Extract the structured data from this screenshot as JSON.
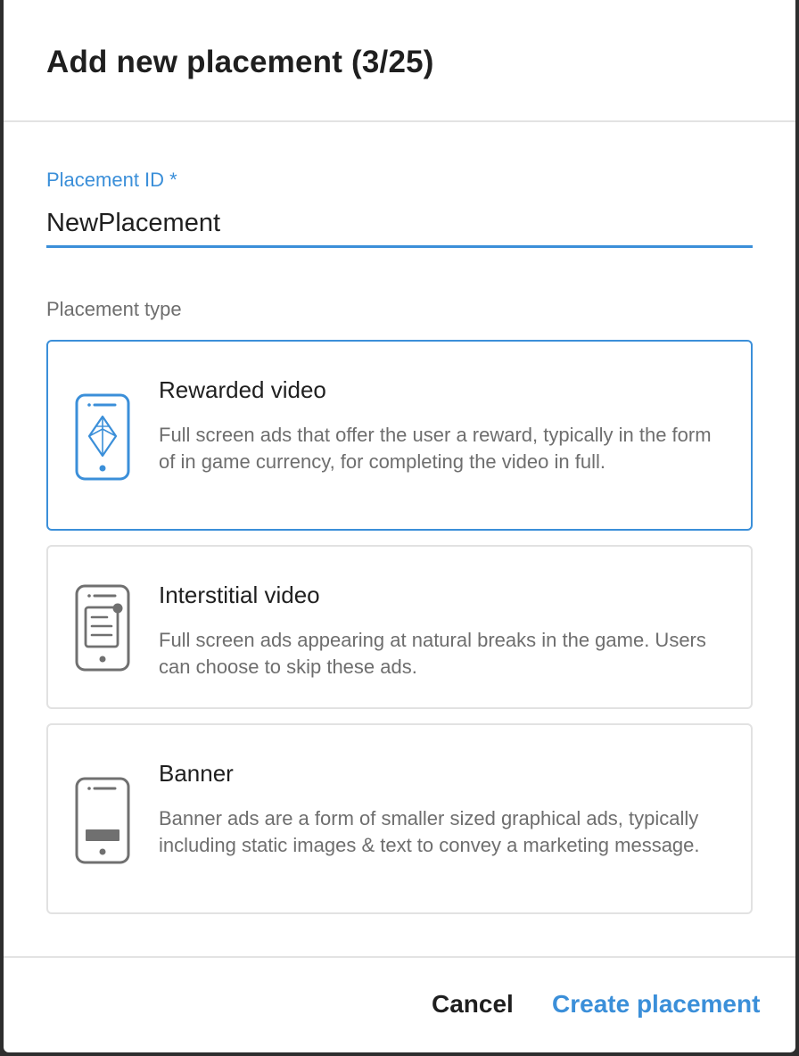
{
  "dialog": {
    "title": "Add new placement (3/25)"
  },
  "placement_id": {
    "label": "Placement ID *",
    "value": "NewPlacement"
  },
  "placement_type": {
    "label": "Placement type",
    "options": [
      {
        "title": "Rewarded video",
        "description": "Full screen ads that offer the user a reward, typically in the form of in game currency, for completing the video in full.",
        "icon": "phone-diamond-icon",
        "selected": true
      },
      {
        "title": "Interstitial video",
        "description": "Full screen ads appearing at natural breaks in the game. Users can choose to skip these ads.",
        "icon": "phone-document-icon",
        "selected": false
      },
      {
        "title": "Banner",
        "description": "Banner ads are a form of smaller sized graphical ads, typically including static images & text to convey a marketing message.",
        "icon": "phone-banner-icon",
        "selected": false
      }
    ]
  },
  "footer": {
    "cancel_label": "Cancel",
    "create_label": "Create placement"
  },
  "colors": {
    "accent": "#3b8fd9",
    "text": "#1f1f1f",
    "muted": "#6e6e6e",
    "border": "#e2e2e2",
    "icon_inactive": "#707070"
  }
}
